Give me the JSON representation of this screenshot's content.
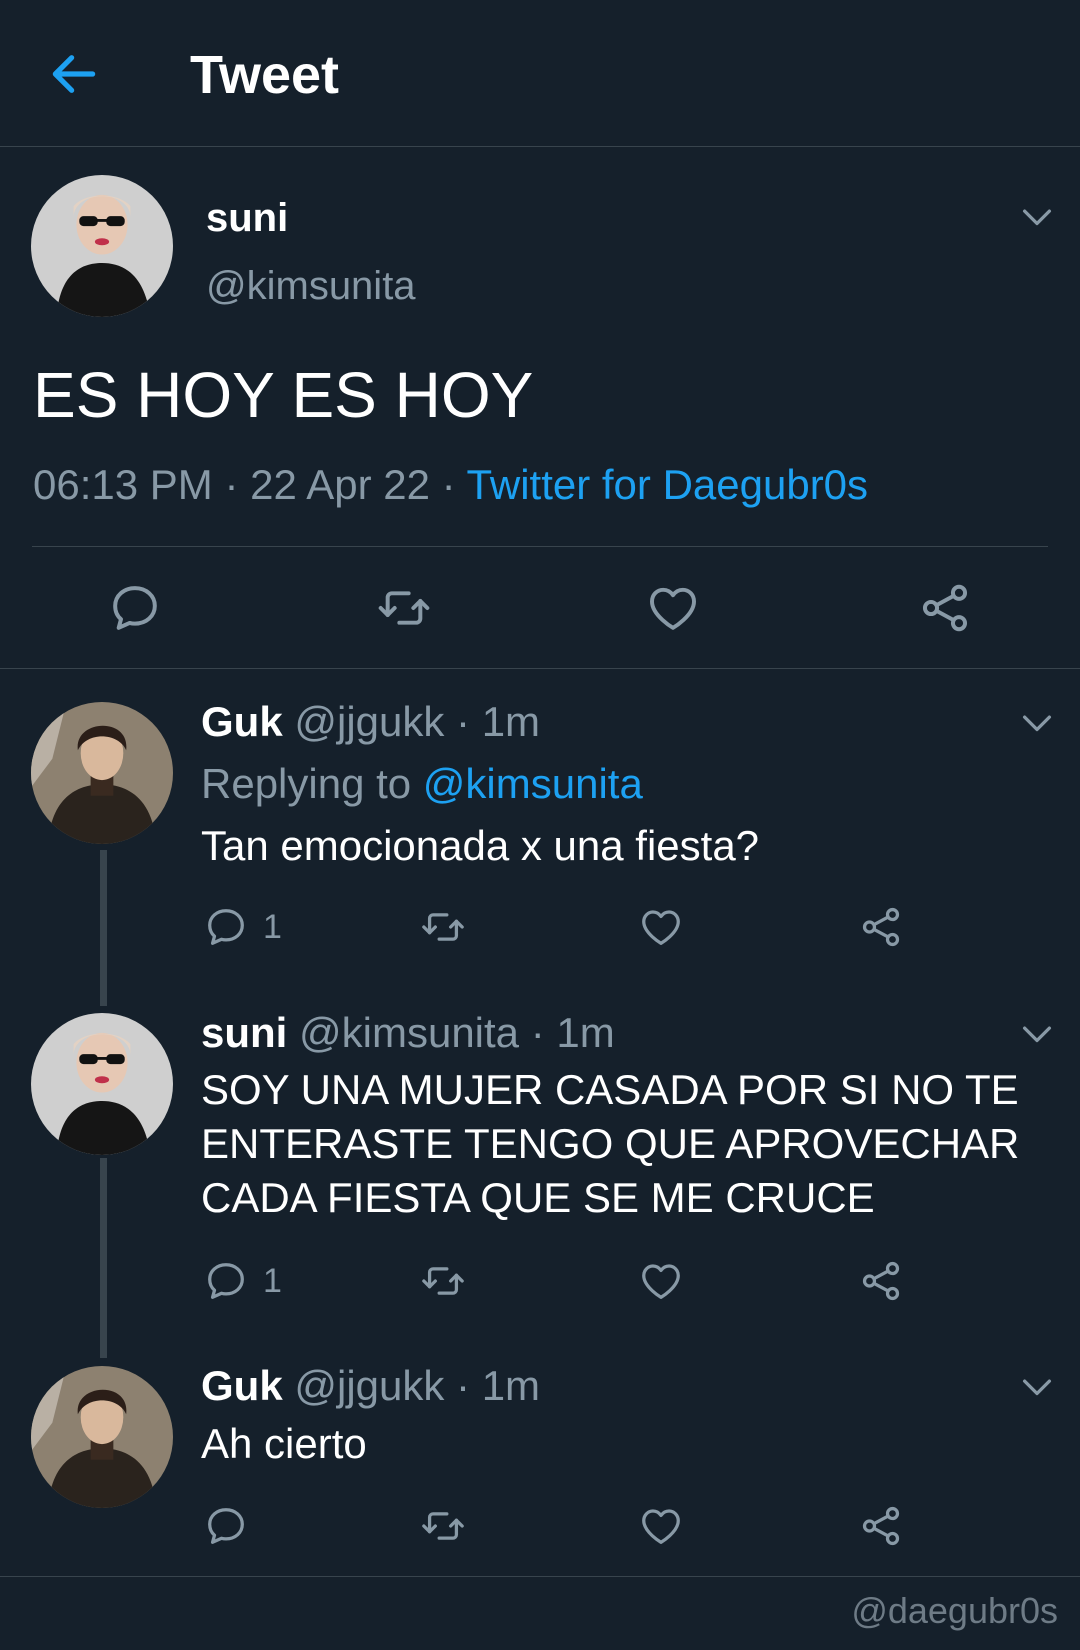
{
  "header": {
    "title": "Tweet",
    "back_icon": "arrow-left-icon"
  },
  "colors": {
    "background": "#15202b",
    "accent": "#1da1f2",
    "secondary_text": "#8899a6",
    "divider": "#38444d"
  },
  "main_tweet": {
    "display_name": "suni",
    "handle": "@kimsunita",
    "text": "ES HOY ES HOY",
    "time": "06:13 PM",
    "separator": "·",
    "date": "22 Apr 22",
    "source": "Twitter for Daegubr0s",
    "actions": [
      "reply-icon",
      "retweet-icon",
      "like-icon",
      "share-icon"
    ]
  },
  "replies": [
    {
      "display_name": "Guk",
      "handle": "@jjgukk",
      "time": "· 1m",
      "replying_label": "Replying to",
      "replying_handle": "@kimsunita",
      "text": "Tan emocionada x una fiesta?",
      "reply_count": "1"
    },
    {
      "display_name": "suni",
      "handle": "@kimsunita",
      "time": "· 1m",
      "text_lines": [
        "SOY UNA MUJER CASADA POR SI NO TE",
        "ENTERASTE TENGO QUE APROVECHAR",
        "CADA FIESTA QUE SE ME CRUCE"
      ],
      "reply_count": "1"
    },
    {
      "display_name": "Guk",
      "handle": "@jjgukk",
      "time": "· 1m",
      "text": "Ah cierto",
      "reply_count": ""
    }
  ],
  "watermark": "@daegubr0s"
}
